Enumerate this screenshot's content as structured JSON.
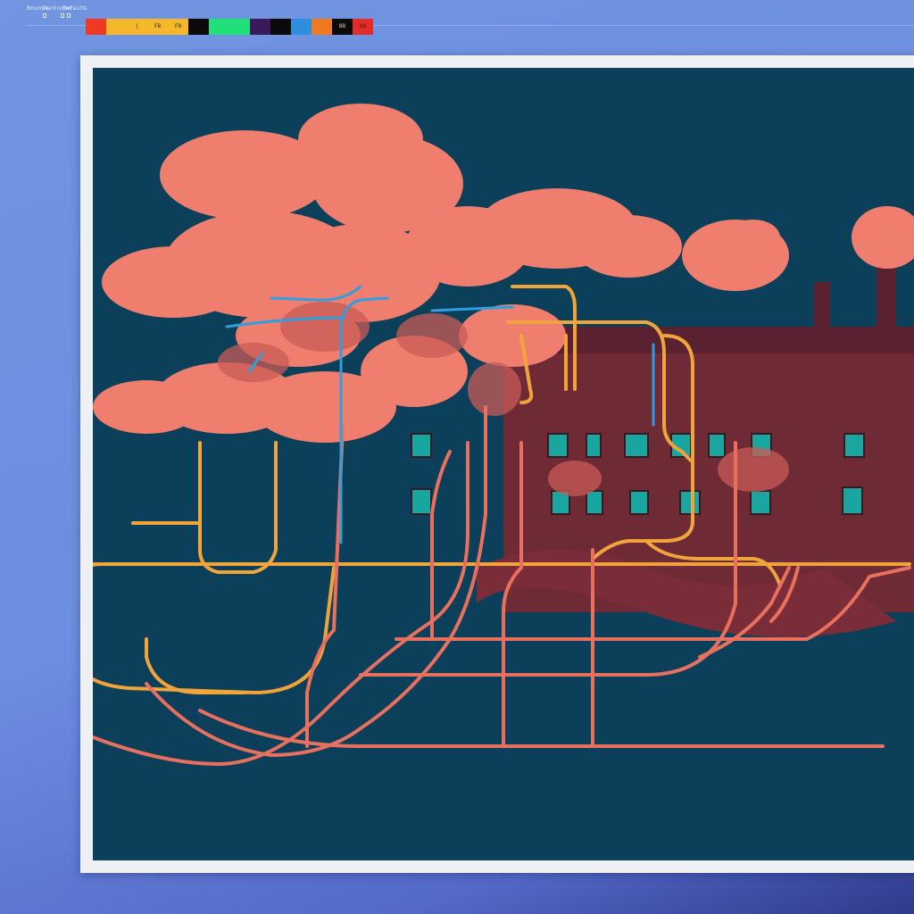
{
  "menu": {
    "items": [
      "Bounce",
      "Darkroom",
      "Defaults"
    ]
  },
  "palette": {
    "swatches": [
      {
        "color": "#ee3a22",
        "label": ""
      },
      {
        "color": "#f5b82a",
        "label": ""
      },
      {
        "color": "#f5b82a",
        "label": "|"
      },
      {
        "color": "#f5b82a",
        "label": "FB"
      },
      {
        "color": "#f5b82a",
        "label": "FB"
      },
      {
        "color": "#0a0a0a",
        "label": ""
      },
      {
        "color": "#20e07a",
        "label": ""
      },
      {
        "color": "#20e07a",
        "label": ""
      },
      {
        "color": "#3b1a5a",
        "label": ""
      },
      {
        "color": "#0a0a0a",
        "label": ""
      },
      {
        "color": "#2e8fe0",
        "label": ""
      },
      {
        "color": "#f07a22",
        "label": ""
      },
      {
        "color": "#0a0a0a",
        "label": "88"
      },
      {
        "color": "#e52a2a",
        "label": "88"
      }
    ]
  },
  "colors": {
    "canvas": "#0c3f59",
    "clouds": "#f07e6e",
    "building": "#6e2a35",
    "line_orange": "#f0a43a",
    "line_salmon": "#e8705e",
    "line_blue": "#2e9fe0",
    "window": "#1aa6a0"
  }
}
